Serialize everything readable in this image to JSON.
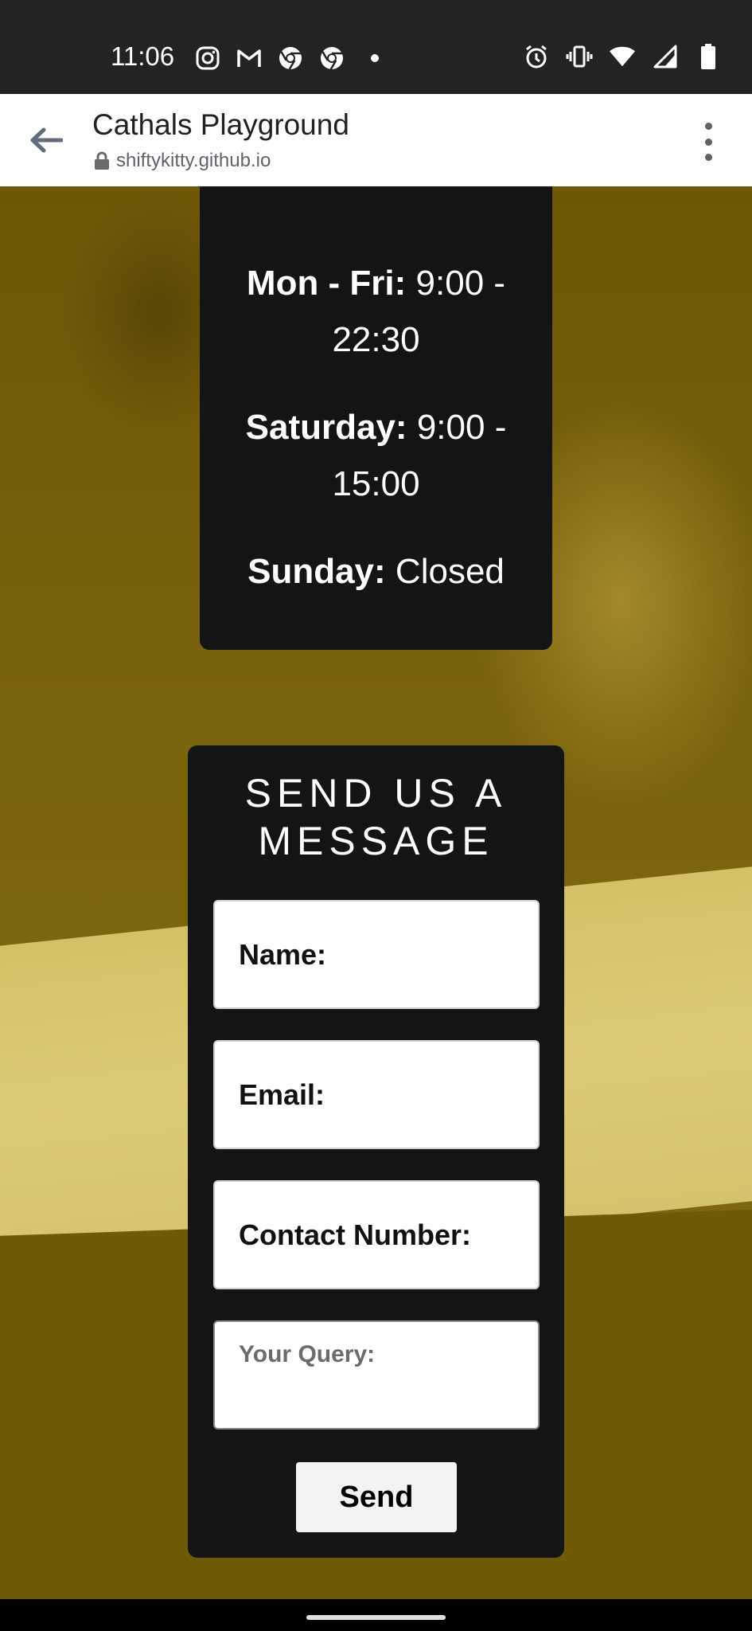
{
  "status_bar": {
    "time": "11:06",
    "left_icons": [
      "instagram-icon",
      "gmail-icon",
      "chrome-icon",
      "chrome-icon",
      "dot-icon"
    ],
    "right_icons": [
      "alarm-icon",
      "vibrate-icon",
      "wifi-icon",
      "signal-icon",
      "battery-icon"
    ]
  },
  "browser": {
    "title": "Cathals Playground",
    "url": "shiftykitty.github.io"
  },
  "hours": {
    "weekday_label": "Mon - Fri:",
    "weekday_value_1": "9:00 -",
    "weekday_value_2": "22:30",
    "saturday_label": "Saturday:",
    "saturday_value_1": "9:00 -",
    "saturday_value_2": "15:00",
    "sunday_label": "Sunday:",
    "sunday_value": "Closed"
  },
  "form": {
    "title_line1": "SEND US A",
    "title_line2": "MESSAGE",
    "name_placeholder": "Name:",
    "email_placeholder": "Email:",
    "contact_placeholder": "Contact Number:",
    "query_placeholder": "Your Query:",
    "send_label": "Send"
  },
  "colors": {
    "background": "#7a6410",
    "card": "#141414",
    "status_bar": "#222324"
  }
}
